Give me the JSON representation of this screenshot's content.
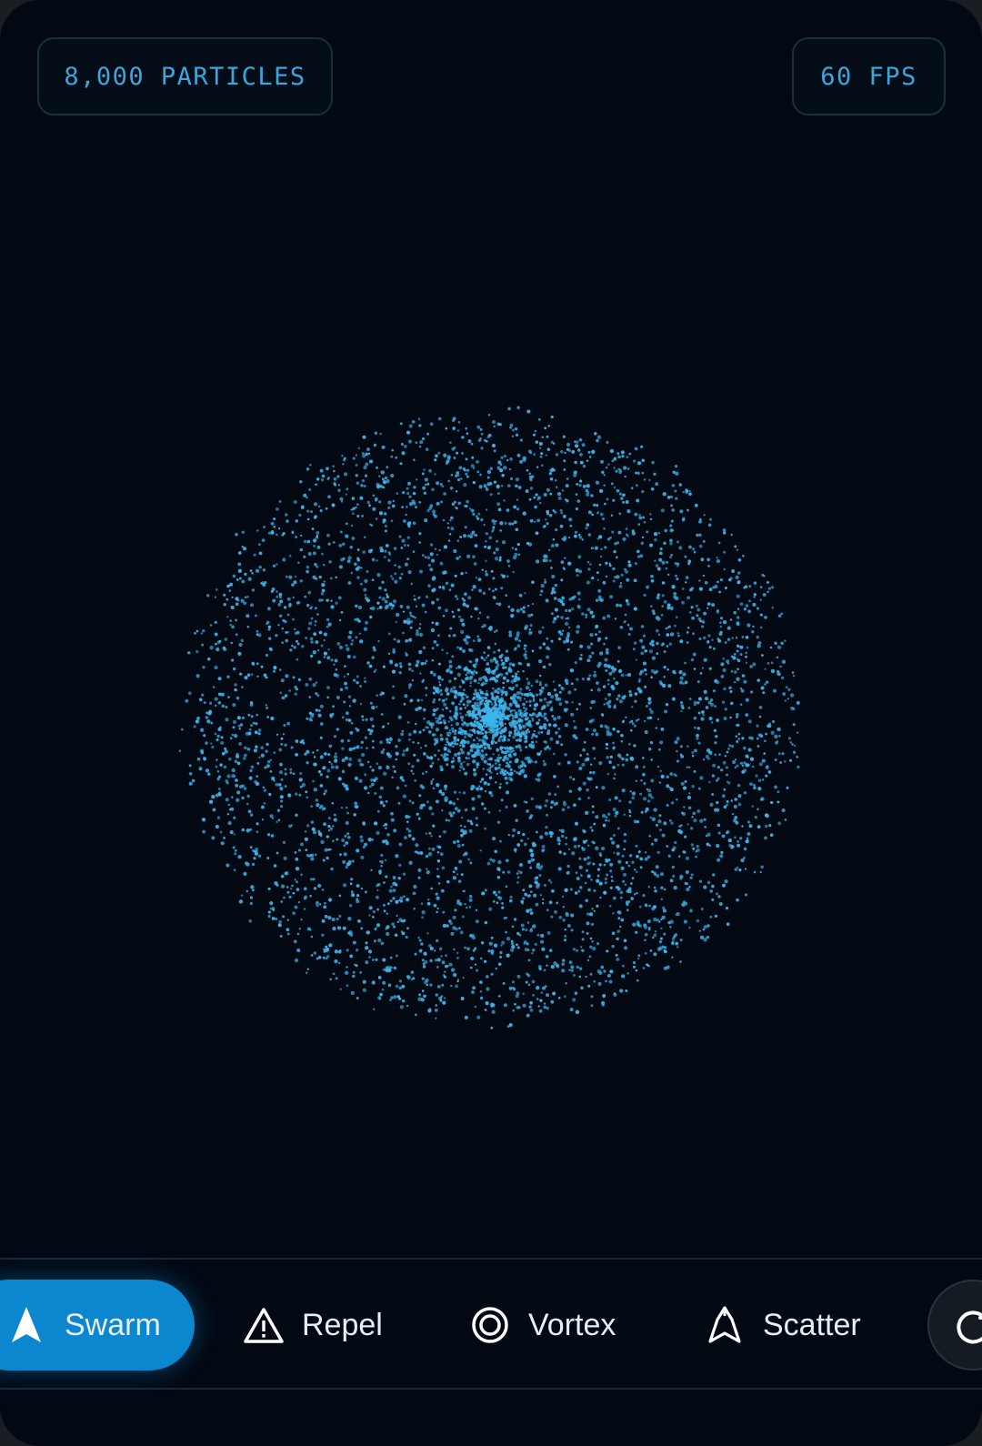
{
  "hud": {
    "particles_label": "8,000 PARTICLES",
    "fps_label": "60 FPS"
  },
  "particle_field": {
    "particle_color": "#3db4ec",
    "background_color": "#030913"
  },
  "toolbar": {
    "modes": [
      {
        "label": "Swarm",
        "icon": "navigation-arrow-icon",
        "active": true
      },
      {
        "label": "Repel",
        "icon": "warning-triangle-icon",
        "active": false
      },
      {
        "label": "Vortex",
        "icon": "target-rings-icon",
        "active": false
      },
      {
        "label": "Scatter",
        "icon": "scatter-arrow-icon",
        "active": false
      }
    ],
    "reset_icon": "refresh-icon",
    "active_color": "#0a87cf"
  }
}
